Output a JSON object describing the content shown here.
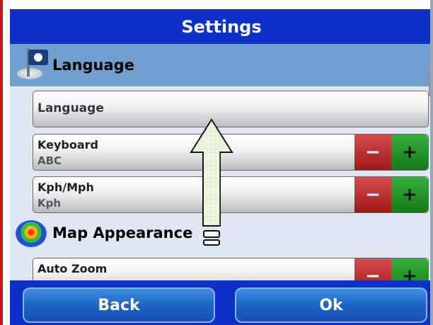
{
  "title": "Settings",
  "sections": {
    "language": {
      "label": "Language",
      "icon": "flag-icon"
    },
    "map_appearance": {
      "label": "Map Appearance",
      "icon": "map-layers-icon"
    }
  },
  "rows": {
    "language": {
      "label": "Language"
    },
    "keyboard": {
      "label": "Keyboard",
      "value": "ABC"
    },
    "speed": {
      "label": "Kph/Mph",
      "value": "Kph"
    },
    "auto_zoom": {
      "label": "Auto Zoom"
    }
  },
  "controls": {
    "minus": "−",
    "plus": "+"
  },
  "footer": {
    "back": "Back",
    "ok": "Ok"
  },
  "colors": {
    "title_bar": "#0b31c9",
    "section_header": "#6fa0d0",
    "minus": "#b82828",
    "plus": "#1f8a22"
  }
}
